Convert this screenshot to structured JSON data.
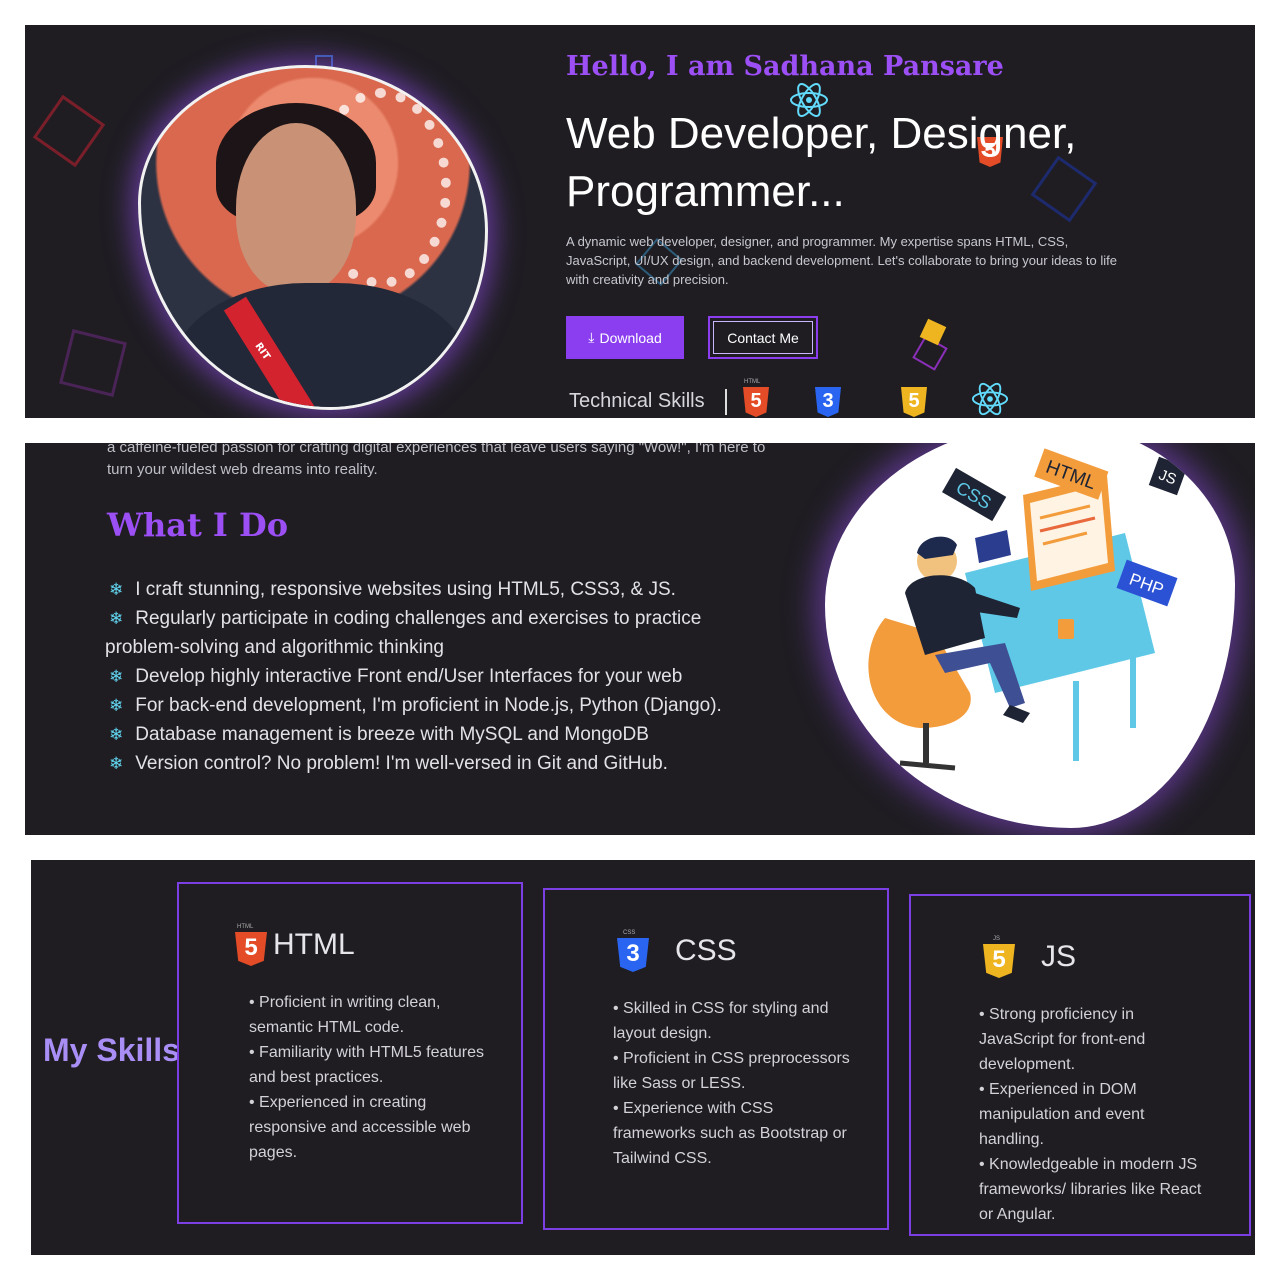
{
  "hero": {
    "greeting": "Hello, I am Sadhana Pansare",
    "headline": "Web Developer, Designer, Programmer...",
    "intro": "A dynamic web developer, designer, and programmer. My expertise spans HTML, CSS, JavaScript, UI/UX design, and backend development. Let's collaborate to bring your ideas to life with creativity and precision.",
    "download_label": "Download",
    "contact_label": "Contact Me",
    "tech_skills_label": "Technical Skills",
    "photo_tag": "RIT",
    "tech_icons": [
      "html5-icon",
      "css3-icon",
      "js-icon",
      "react-icon"
    ]
  },
  "what_i_do": {
    "cut_text": "a caffeine-fueled passion for crafting digital experiences that leave users saying \"Wow!\", I'm here to turn your wildest web dreams into reality.",
    "title": "What I Do",
    "items": [
      "I craft stunning, responsive websites using HTML5, CSS3, & JS.",
      "Regularly participate in coding challenges and exercises to practice problem-solving and algorithmic thinking",
      "Develop highly interactive Front end/User Interfaces for your web",
      "For back-end development, I'm proficient in Node.js, Python (Django).",
      "Database management is breeze with MySQL and MongoDB",
      "Version control? No problem! I'm well-versed in Git and GitHub."
    ],
    "illustration_tags": [
      "HTML",
      "CSS",
      "JS",
      "PHP"
    ]
  },
  "skills": {
    "title": "My Skills",
    "cards": [
      {
        "name": "HTML",
        "icon_tag": "HTML",
        "icon": "html5-icon",
        "points": [
          "• Proficient in writing clean, semantic HTML code.",
          "• Familiarity with HTML5 features and best practices.",
          "• Experienced in creating responsive and accessible web pages."
        ]
      },
      {
        "name": "CSS",
        "icon_tag": "CSS",
        "icon": "css3-icon",
        "points": [
          "• Skilled in CSS for styling and layout design.",
          "• Proficient in CSS preprocessors like Sass or LESS.",
          "• Experience with CSS frameworks such as Bootstrap or Tailwind CSS."
        ]
      },
      {
        "name": "JS",
        "icon_tag": "JS",
        "icon": "js-icon",
        "points": [
          "• Strong proficiency in JavaScript for front-end development.",
          "• Experienced in DOM manipulation and event handling.",
          "• Knowledgeable in modern JS frameworks/ libraries like React or Angular."
        ]
      }
    ]
  },
  "colors": {
    "background": "#1f1d22",
    "accent": "#8a3ef0",
    "heading_purple": "#9b4ff5",
    "bullet_cyan": "#63d7f2"
  }
}
